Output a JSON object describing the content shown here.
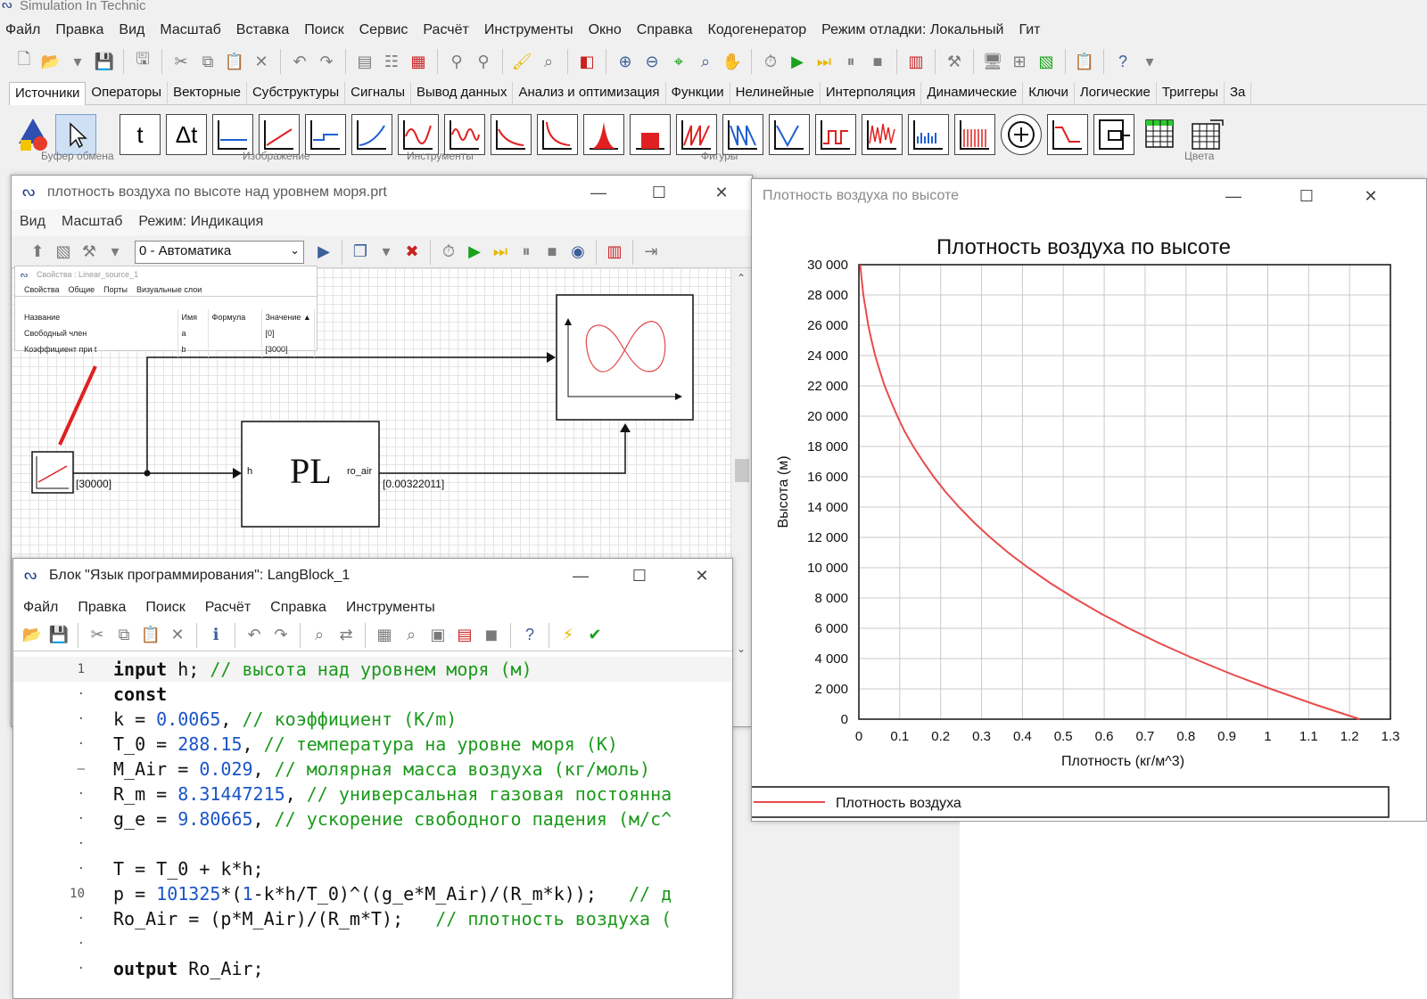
{
  "app": {
    "title": "Simulation In Technic"
  },
  "menu": [
    "Файл",
    "Правка",
    "Вид",
    "Масштаб",
    "Вставка",
    "Поиск",
    "Сервис",
    "Расчёт",
    "Инструменты",
    "Окно",
    "Справка",
    "Кодогенератор",
    "Режим отладки: Локальный",
    "Гит"
  ],
  "palette_tabs": [
    "Источники",
    "Операторы",
    "Векторные",
    "Субструктуры",
    "Сигналы",
    "Вывод данных",
    "Анализ и оптимизация",
    "Функции",
    "Нелинейные",
    "Интерполяция",
    "Динамические",
    "Ключи",
    "Логические",
    "Триггеры",
    "За"
  ],
  "palette_groups": [
    "Буфер обмена",
    "Изображение",
    "Инструменты",
    "Фигуры",
    "Цвета"
  ],
  "palette_icons": [
    "t",
    "Δt"
  ],
  "diagram_window": {
    "title": "плотность воздуха по высоте над уровнем моря.prt",
    "menu": [
      "Вид",
      "Масштаб",
      "Режим: Индикация"
    ],
    "mode_select": "0 - Автоматика",
    "source_value": "[30000]",
    "block_label": "PL",
    "port_in": "h",
    "port_out": "ro_air",
    "output_value": "[0.00322011]"
  },
  "props_panel": {
    "title": "Свойства : Linear_source_1",
    "tabs": [
      "Свойства",
      "Общие",
      "Порты",
      "Визуальные слои"
    ],
    "headers": [
      "Название",
      "Имя",
      "Формула",
      "Значение ▲"
    ],
    "rows": [
      [
        "Свободный член",
        "a",
        "",
        "[0]"
      ],
      [
        "Коэффициент при t",
        "b",
        "",
        "[3000]"
      ]
    ]
  },
  "code_window": {
    "title": "Блок \"Язык программирования\": LangBlock_1",
    "menu": [
      "Файл",
      "Правка",
      "Поиск",
      "Расчёт",
      "Справка",
      "Инструменты"
    ],
    "line_numbers": [
      "1",
      "·",
      "·",
      "·",
      "–",
      "·",
      "·",
      "·",
      "·",
      "10",
      "·",
      "·",
      "·"
    ]
  },
  "chart_window": {
    "title": "Плотность воздуха по высоте"
  },
  "chart_data": {
    "type": "line",
    "title": "Плотность воздуха по высоте",
    "xlabel": "Плотность (кг/м^3)",
    "ylabel": "Высота (м)",
    "xlim": [
      0,
      1.3
    ],
    "ylim": [
      0,
      30000
    ],
    "x_ticks": [
      "0",
      "0.1",
      "0.2",
      "0.3",
      "0.4",
      "0.5",
      "0.6",
      "0.7",
      "0.8",
      "0.9",
      "1",
      "1.1",
      "1.2",
      "1.3"
    ],
    "y_ticks": [
      "0",
      "2 000",
      "4 000",
      "6 000",
      "8 000",
      "10 000",
      "12 000",
      "14 000",
      "16 000",
      "18 000",
      "20 000",
      "22 000",
      "24 000",
      "26 000",
      "28 000",
      "30 000"
    ],
    "grid": true,
    "legend_position": "bottom",
    "series": [
      {
        "name": "Плотность воздуха",
        "color": "#e84c4c",
        "x": [
          1.225,
          1.112,
          1.007,
          0.909,
          0.819,
          0.736,
          0.66,
          0.59,
          0.526,
          0.467,
          0.414,
          0.365,
          0.321,
          0.281,
          0.245,
          0.212,
          0.183,
          0.157,
          0.133,
          0.112,
          0.094,
          0.078,
          0.063,
          0.051,
          0.04,
          0.031,
          0.023,
          0.017,
          0.011,
          0.007,
          0.0032
        ],
        "y": [
          0,
          1000,
          2000,
          3000,
          4000,
          5000,
          6000,
          7000,
          8000,
          9000,
          10000,
          11000,
          12000,
          13000,
          14000,
          15000,
          16000,
          17000,
          18000,
          19000,
          20000,
          21000,
          22000,
          23000,
          24000,
          25000,
          26000,
          27000,
          28000,
          29000,
          30000
        ]
      }
    ]
  },
  "colors": {
    "accent": "#1f3d8a",
    "curve": "#e84c4c",
    "comment": "#1c9a1c",
    "number": "#1a55c8"
  }
}
